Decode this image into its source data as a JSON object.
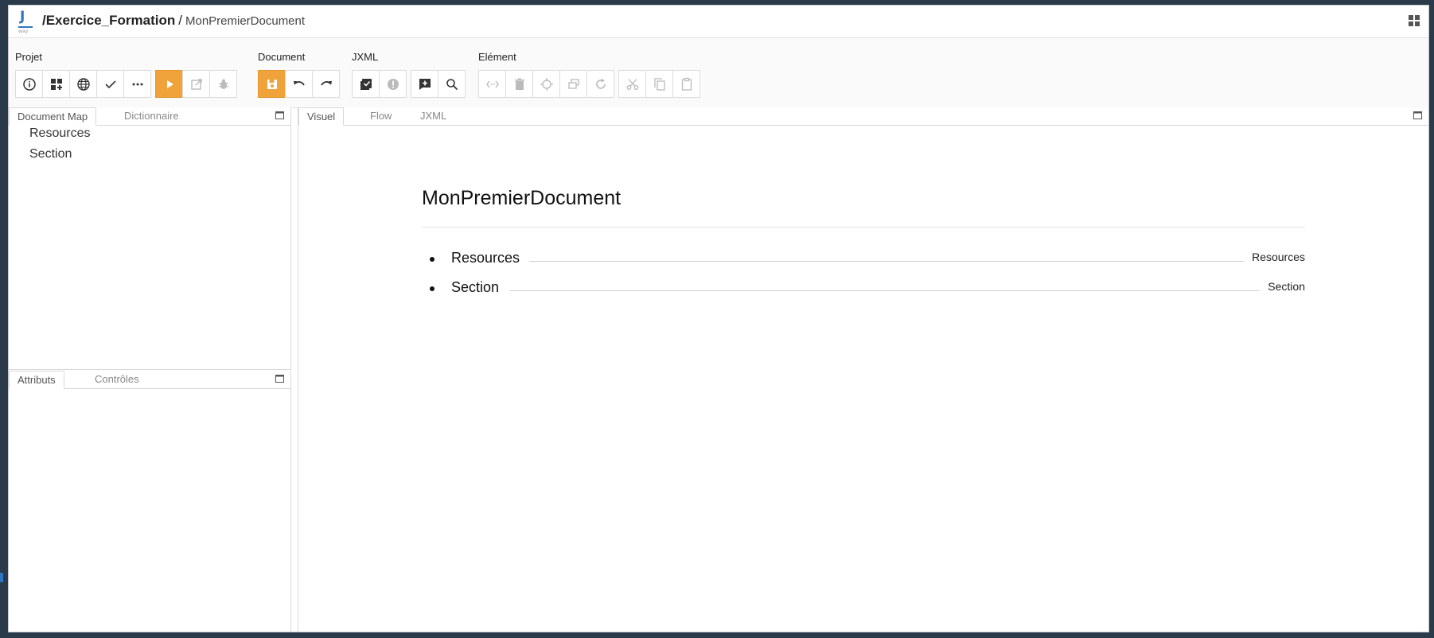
{
  "title": {
    "project": "/Exercice_Formation",
    "separator": "/",
    "document": "MonPremierDocument"
  },
  "toolbar": {
    "projet_label": "Projet",
    "document_label": "Document",
    "jxml_label": "JXML",
    "element_label": "Elément",
    "accent_color": "#f0a23b"
  },
  "left_top": {
    "tabs": [
      "Document Map",
      "Dictionnaire"
    ],
    "items": [
      "Resources",
      "Section"
    ]
  },
  "left_bottom": {
    "tabs": [
      "Attributs",
      "Contrôles"
    ]
  },
  "editor": {
    "tabs": [
      "Visuel",
      "Flow",
      "JXML"
    ],
    "doc_title": "MonPremierDocument",
    "toc": [
      {
        "label": "Resources",
        "ref": "Resources"
      },
      {
        "label": "Section",
        "ref": "Section"
      }
    ]
  }
}
